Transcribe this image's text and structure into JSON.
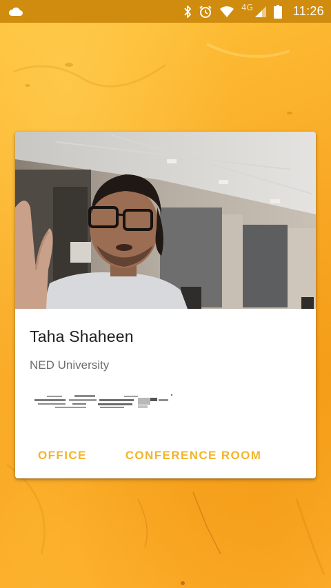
{
  "status_bar": {
    "network_type": "4G",
    "time": "11:26",
    "icons": [
      "cloud-icon",
      "bluetooth-icon",
      "alarm-icon",
      "wifi-icon",
      "cellular-signal-icon",
      "battery-icon"
    ]
  },
  "card": {
    "name": "Taha Shaheen",
    "organization": "NED University",
    "actions": [
      {
        "label": "OFFICE"
      },
      {
        "label": "CONFERENCE ROOM"
      }
    ]
  },
  "colors": {
    "status_bar": "#d08c0f",
    "background": "#f9a825",
    "accent": "#f2b52a",
    "name_text": "#212121",
    "secondary_text": "#6d6d6d"
  }
}
